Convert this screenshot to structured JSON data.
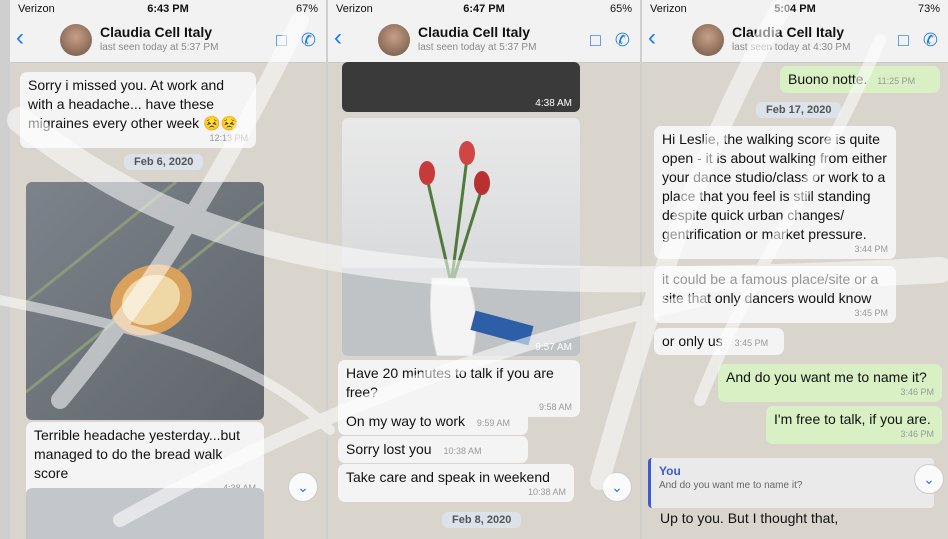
{
  "panels": [
    {
      "status": {
        "carrier": "Verizon",
        "time": "6:43 PM",
        "battery": "67%"
      },
      "header": {
        "name": "Claudia Cell Italy",
        "last_seen": "last seen today at 5:37 PM"
      },
      "messages": [
        {
          "text": "Sorry i missed you. At work and with a headache... have these migraines every other week 😣😣",
          "time": "12:13 PM"
        },
        {
          "text": "Terrible headache yesterday...but managed to do the bread walk score",
          "time": "4:38 AM"
        }
      ],
      "date": "Feb 6, 2020"
    },
    {
      "status": {
        "carrier": "Verizon",
        "time": "6:47 PM",
        "battery": "65%"
      },
      "header": {
        "name": "Claudia Cell Italy",
        "last_seen": "last seen today at 5:37 PM"
      },
      "image_times": [
        "4:38 AM",
        "9:57 AM"
      ],
      "messages": [
        {
          "text": "Have 20 minutes to talk if you are free?",
          "time": "9:58 AM"
        },
        {
          "text": "On my way to work",
          "time": "9:59 AM"
        },
        {
          "text": "Sorry lost you",
          "time": "10:38 AM"
        },
        {
          "text": "Take care and speak in weekend",
          "time": "10:38 AM"
        }
      ],
      "date": "Feb 8, 2020"
    },
    {
      "status": {
        "carrier": "Verizon",
        "time": "5:04 PM",
        "battery": "73%"
      },
      "header": {
        "name": "Claudia Cell Italy",
        "last_seen": "last seen today at 4:30 PM"
      },
      "date": "Feb 17, 2020",
      "messages": [
        {
          "text": "Buono notte.",
          "time": "11:25 PM",
          "dir": "out"
        },
        {
          "text": "Hi Leslie, the walking score is quite open - it is about walking from either your dance studio/class or work to a place that you feel is still standing despite quick urban changes/ gentrification or market pressure.",
          "time": "3:44 PM"
        },
        {
          "text": "it could be a famous place/site or a site that only dancers would know",
          "time": "3:45 PM"
        },
        {
          "text": "or only us",
          "time": "3:45 PM"
        },
        {
          "text": "And do you want me to name it?",
          "time": "3:46 PM",
          "dir": "out"
        },
        {
          "text": "I'm free to talk, if you are.",
          "time": "3:46 PM",
          "dir": "out"
        }
      ],
      "reply": {
        "author": "You",
        "quoted": "And do you want me to name it?",
        "text": "Up to you. But I thought that,"
      }
    }
  ],
  "icons": {
    "back": "chevron-left-icon",
    "video": "video-call-icon",
    "phone": "phone-icon",
    "scroll": "scroll-down-icon"
  }
}
